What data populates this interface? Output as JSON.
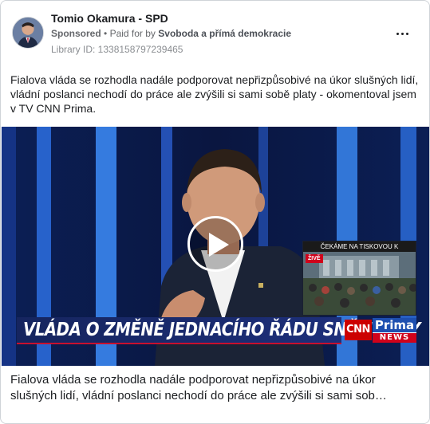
{
  "post": {
    "page_name": "Tomio Okamura - SPD",
    "sponsored_label": "Sponsored",
    "separator": "•",
    "paid_for_by_label": "Paid for by",
    "payer": "Svoboda a přímá demokracie",
    "library_id": "Library ID: 1338158797239465",
    "more_icon": "more-horizontal-icon",
    "body_text": "Fialova vláda se rozhodla nadále podporovat nepřizpůsobivé na úkor slušných lidí, vládní poslanci nechodí do práce ale zvýšili si sami sobě platy - okomentoval jsem v TV CNN Prima."
  },
  "video": {
    "play_icon": "play-icon",
    "chyron": "VLÁDA O ZMĚNĚ JEDNACÍHO ŘÁDU SNĚMOVNY",
    "inset_title": "ČEKÁME NA TISKOVOU K",
    "live_label": "ŽIVĚ",
    "cnn_logo": "CNN",
    "prima_logo": "Prima",
    "news_logo": "NEWS"
  },
  "caption": {
    "line1": "Fialova vláda se rozhodla nadále podporovat nepřizpůsobivé na úkor",
    "line2": "slušných lidí, vládní poslanci nechodí do práce ale zvýšili si sami sob…"
  },
  "colors": {
    "text": "#1c1e21",
    "secondary_text": "#65676b",
    "chyron_bg": "#1d2f7a",
    "cnn_red": "#cc0000",
    "prima_blue": "#1d4fb0"
  }
}
